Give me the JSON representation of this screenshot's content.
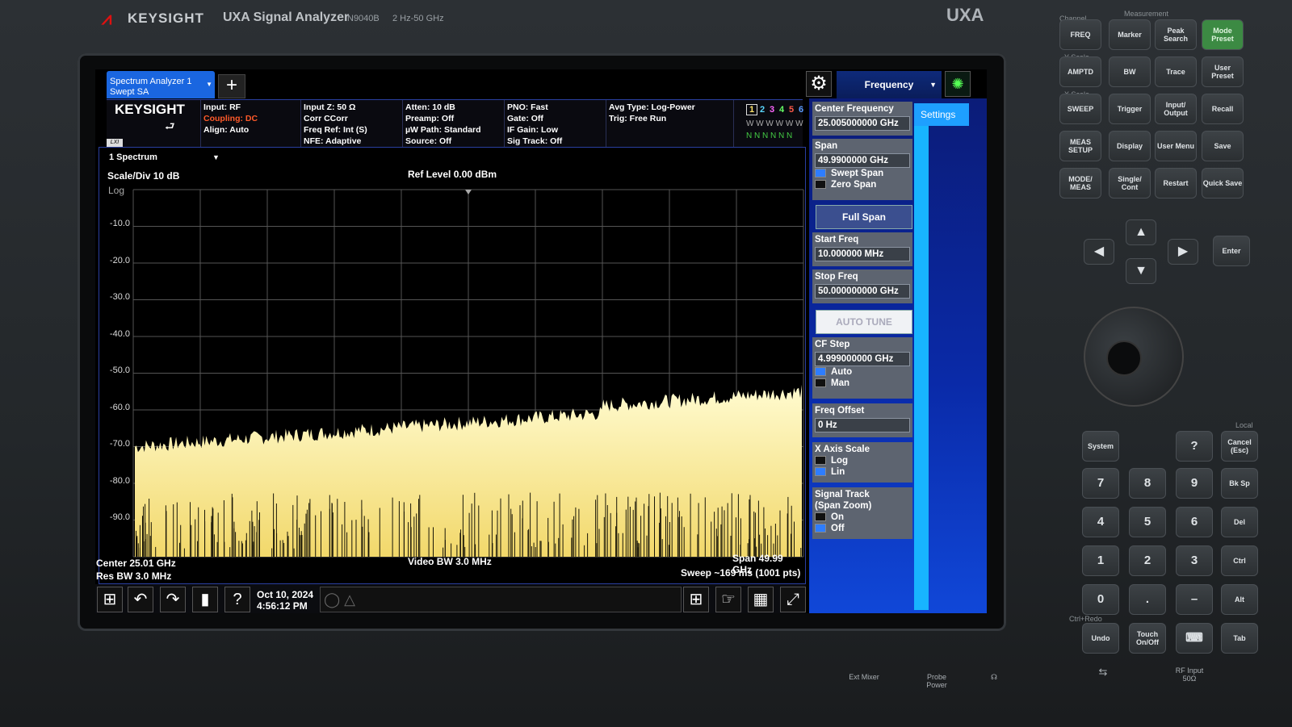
{
  "instrument": {
    "brand": "KEYSIGHT",
    "title": "UXA Signal Analyzer",
    "model": "N9040B",
    "range": "2 Hz-50 GHz",
    "series": "UXA"
  },
  "topbar": {
    "tab_line1": "Spectrum Analyzer 1",
    "tab_line2": "Swept SA",
    "add_tab": "+",
    "menu_selector": "Frequency"
  },
  "info": {
    "logo": "KEYSIGHT",
    "lxi": "LXI",
    "col1": [
      "Input: RF",
      "Coupling: DC",
      "Align: Auto"
    ],
    "col2": [
      "Input Z: 50 Ω",
      "Corr CCorr",
      "Freq Ref: Int (S)",
      "NFE: Adaptive"
    ],
    "col3": [
      "Atten: 10 dB",
      "Preamp: Off",
      "µW Path: Standard",
      "Source: Off"
    ],
    "col4": [
      "PNO: Fast",
      "Gate: Off",
      "IF Gain: Low",
      "Sig Track: Off"
    ],
    "col5": [
      "Avg Type: Log-Power",
      "Trig: Free Run"
    ],
    "traces": {
      "numbers": [
        "1",
        "2",
        "3",
        "4",
        "5",
        "6"
      ],
      "colors": [
        "#ffe36a",
        "#5ad7ff",
        "#ff66ff",
        "#66ff66",
        "#ff5a4a",
        "#5a9cff"
      ],
      "row2": "W W W W W W",
      "row3": "N N N N N N"
    }
  },
  "graph": {
    "window_label": "1 Spectrum",
    "scale": "Scale/Div 10 dB",
    "scale_type": "Log",
    "ref_level": "Ref Level 0.00 dBm",
    "y_ticks": [
      "-10.0",
      "-20.0",
      "-30.0",
      "-40.0",
      "-50.0",
      "-60.0",
      "-70.0",
      "-80.0",
      "-90.0"
    ],
    "center": "Center 25.01 GHz",
    "res_bw": "Res BW 3.0 MHz",
    "video_bw": "Video BW 3.0 MHz",
    "span": "Span 49.99 GHz",
    "sweep": "Sweep ~169 ms (1001 pts)",
    "trace_color": "#fff8b0"
  },
  "taskbar": {
    "date": "Oct 10, 2024",
    "time": "4:56:12 PM"
  },
  "panel": {
    "settings_tab": "Settings",
    "center_freq_label": "Center Frequency",
    "center_freq_value": "25.005000000 GHz",
    "span_label": "Span",
    "span_value": "49.9900000 GHz",
    "swept_span": "Swept Span",
    "zero_span": "Zero Span",
    "full_span": "Full Span",
    "start_label": "Start Freq",
    "start_value": "10.000000 MHz",
    "stop_label": "Stop Freq",
    "stop_value": "50.000000000 GHz",
    "auto_tune": "AUTO TUNE",
    "cf_step_label": "CF Step",
    "cf_step_value": "4.999000000 GHz",
    "auto": "Auto",
    "man": "Man",
    "freq_offset_label": "Freq Offset",
    "freq_offset_value": "0 Hz",
    "xaxis_label": "X Axis Scale",
    "log": "Log",
    "lin": "Lin",
    "sigtrack_label1": "Signal Track",
    "sigtrack_label2": "(Span Zoom)",
    "on": "On",
    "off": "Off"
  },
  "keypad": {
    "channel": "Channel",
    "measurement": "Measurement",
    "yscale": "Y Scale",
    "xscale": "X Scale",
    "local": "Local",
    "ctrl_redo": "Ctrl+Redo",
    "freq": "FREQ",
    "marker": "Marker",
    "peak": "Peak Search",
    "mode_preset": "Mode Preset",
    "amptd": "AMPTD",
    "bw": "BW",
    "trace": "Trace",
    "user_preset": "User Preset",
    "sweep": "SWEEP",
    "trigger": "Trigger",
    "input_output": "Input/ Output",
    "recall": "Recall",
    "meas_setup": "MEAS SETUP",
    "display": "Display",
    "user_menu": "User Menu",
    "save": "Save",
    "mode_meas": "MODE/ MEAS",
    "single_cont": "Single/ Cont",
    "restart": "Restart",
    "quick_save": "Quick Save",
    "enter": "Enter",
    "system": "System",
    "question": "?",
    "cancel": "Cancel (Esc)",
    "k7": "7",
    "k8": "8",
    "k9": "9",
    "bksp": "Bk Sp",
    "k4": "4",
    "k5": "5",
    "k6": "6",
    "del": "Del",
    "k1": "1",
    "k2": "2",
    "k3": "3",
    "ctrl": "Ctrl",
    "k0": "0",
    "dot": ".",
    "minus": "–",
    "alt": "Alt",
    "undo": "Undo",
    "touch": "Touch On/Off",
    "tab": "Tab"
  },
  "ports": {
    "ext_mixer": "Ext Mixer",
    "probe_power": "Probe Power",
    "rf_input": "RF Input 50Ω"
  }
}
